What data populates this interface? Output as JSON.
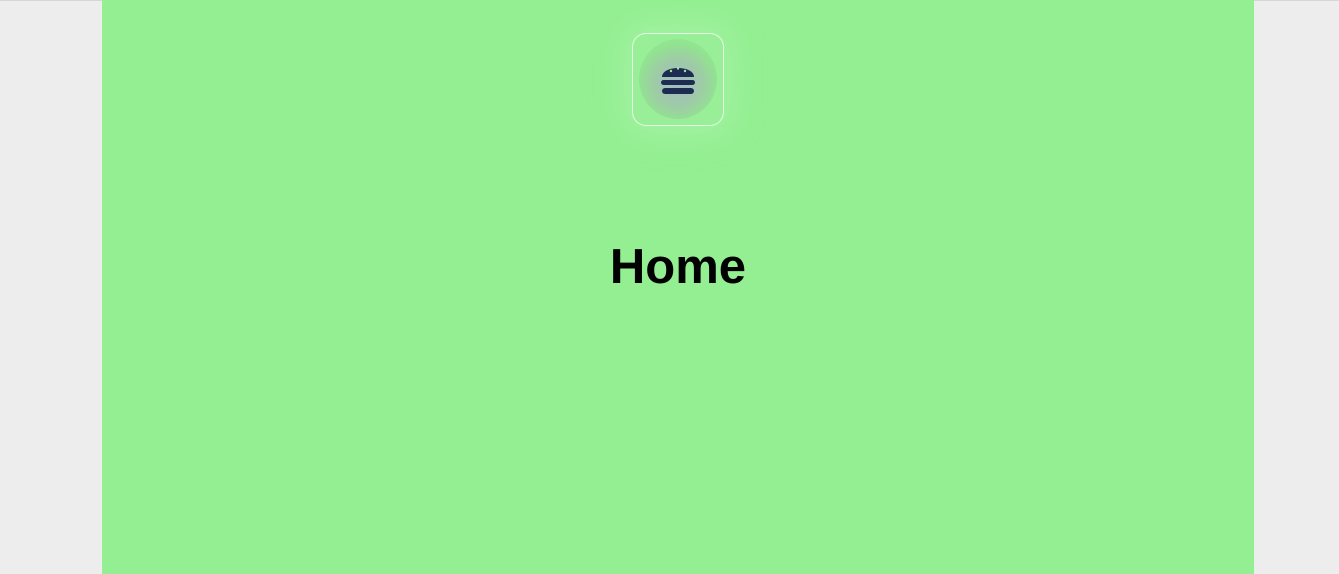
{
  "header": {
    "menu_button": {
      "icon": "burger-icon",
      "color": "#1f2c52"
    }
  },
  "main": {
    "title": "Home"
  },
  "colors": {
    "page_background": "#93ef91",
    "outer_background": "#ededed",
    "title_text": "#000000"
  }
}
